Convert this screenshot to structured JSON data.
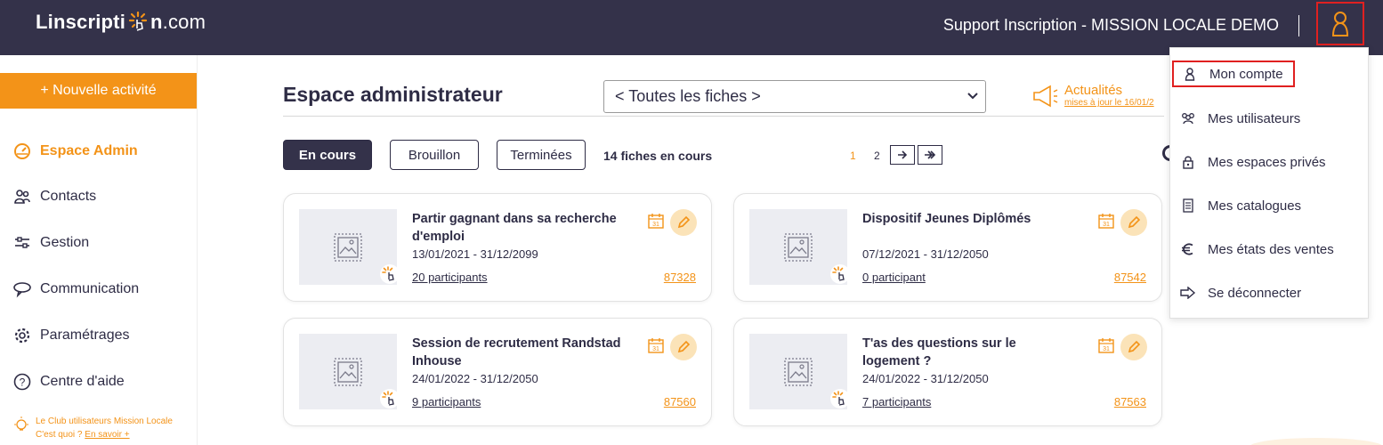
{
  "topbar": {
    "logo_prefix": "Linscripti",
    "logo_after_burst": "n",
    "logo_suffix": ".com",
    "support_text": "Support Inscription - MISSION LOCALE DEMO",
    "user_icon": "user-icon"
  },
  "sidebar": {
    "new_activity_label": "+ Nouvelle activité",
    "items": [
      {
        "label": "Espace Admin",
        "icon": "dashboard-icon",
        "active": true
      },
      {
        "label": "Contacts",
        "icon": "contacts-icon",
        "active": false
      },
      {
        "label": "Gestion",
        "icon": "sliders-icon",
        "active": false
      },
      {
        "label": "Communication",
        "icon": "chat-icon",
        "active": false
      },
      {
        "label": "Paramétrages",
        "icon": "gear-icon",
        "active": false
      },
      {
        "label": "Centre d'aide",
        "icon": "help-icon",
        "active": false
      }
    ],
    "club_line1": "Le Club utilisateurs Mission Locale",
    "club_line2": "C'est quoi ?",
    "club_link": "En savoir +"
  },
  "main": {
    "title": "Espace administrateur",
    "filter_select_value": "< Toutes les fiches >",
    "news_title": "Actualités",
    "news_sub": "mises à jour le 16/01/2",
    "tabs": [
      {
        "label": "En cours",
        "active": true
      },
      {
        "label": "Brouillon",
        "active": false
      },
      {
        "label": "Terminées",
        "active": false
      }
    ],
    "count_text": "14 fiches en cours",
    "pagination": {
      "current": "1",
      "next_page": "2"
    },
    "cards": [
      {
        "title": "Partir gagnant dans sa recherche d'emploi",
        "dates": "13/01/2021 - 31/12/2099",
        "participants": "20 participants",
        "id": "87328"
      },
      {
        "title": "Dispositif Jeunes Diplômés",
        "dates": "07/12/2021 - 31/12/2050",
        "participants": "0 participant",
        "id": "87542"
      },
      {
        "title": "Session de recrutement Randstad Inhouse",
        "dates": "24/01/2022 - 31/12/2050",
        "participants": "9 participants",
        "id": "87560"
      },
      {
        "title": "T'as des questions sur le logement ?",
        "dates": "24/01/2022 - 31/12/2050",
        "participants": "7 participants",
        "id": "87563"
      }
    ]
  },
  "user_menu": {
    "items": [
      {
        "label": "Mon compte",
        "icon": "user-icon"
      },
      {
        "label": "Mes utilisateurs",
        "icon": "users-icon"
      },
      {
        "label": "Mes espaces privés",
        "icon": "lock-icon"
      },
      {
        "label": "Mes catalogues",
        "icon": "document-icon"
      },
      {
        "label": "Mes états des ventes",
        "icon": "euro-icon"
      },
      {
        "label": "Se déconnecter",
        "icon": "logout-icon"
      }
    ]
  },
  "colors": {
    "accent": "#f39318",
    "dark": "#34324a",
    "highlight": "#e02020"
  }
}
